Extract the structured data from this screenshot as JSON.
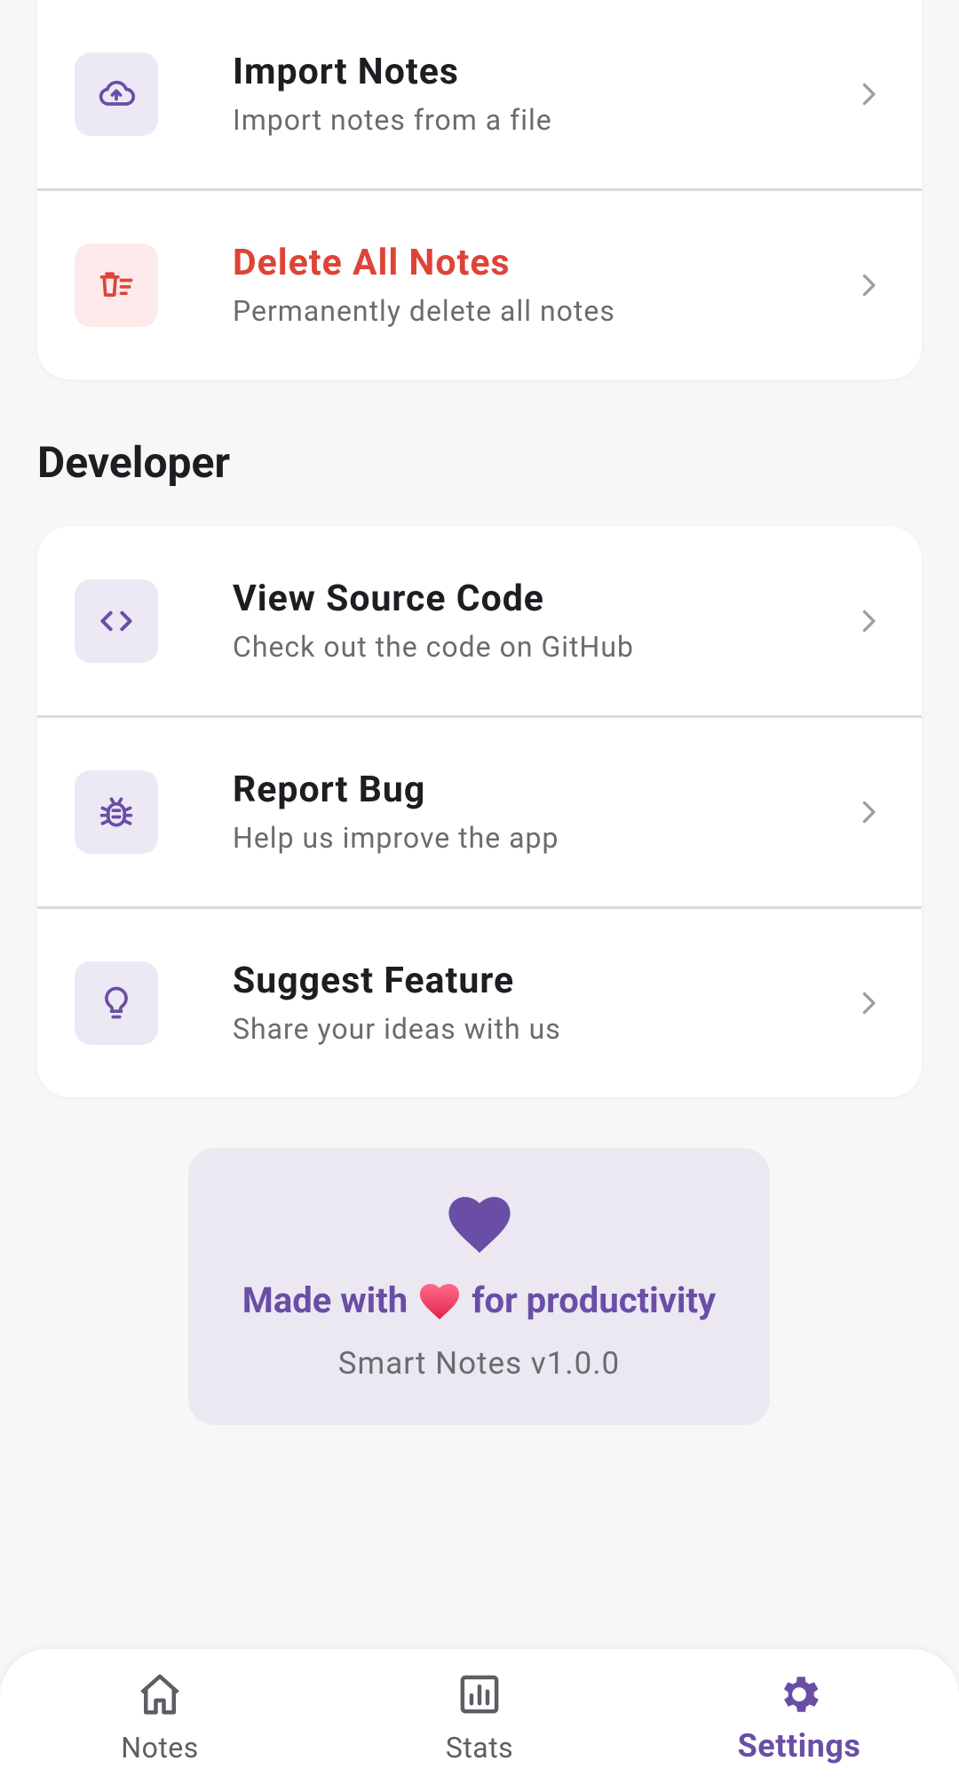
{
  "data_section": {
    "items": [
      {
        "title": "Import Notes",
        "subtitle": "Import notes from a file"
      },
      {
        "title": "Delete All Notes",
        "subtitle": "Permanently delete all notes"
      }
    ]
  },
  "developer_section": {
    "heading": "Developer",
    "items": [
      {
        "title": "View Source Code",
        "subtitle": "Check out the code on GitHub"
      },
      {
        "title": "Report Bug",
        "subtitle": "Help us improve the app"
      },
      {
        "title": "Suggest Feature",
        "subtitle": "Share your ideas with us"
      }
    ]
  },
  "footer": {
    "made_with_prefix": "Made with",
    "made_with_suffix": "for productivity",
    "version": "Smart Notes v1.0.0"
  },
  "bottom_nav": {
    "items": [
      {
        "label": "Notes"
      },
      {
        "label": "Stats"
      },
      {
        "label": "Settings"
      }
    ],
    "active": "Settings"
  },
  "colors": {
    "accent": "#6a4ea6",
    "danger": "#de4436",
    "icon_bg": "#ece8f4",
    "danger_bg": "#fdeaea"
  }
}
